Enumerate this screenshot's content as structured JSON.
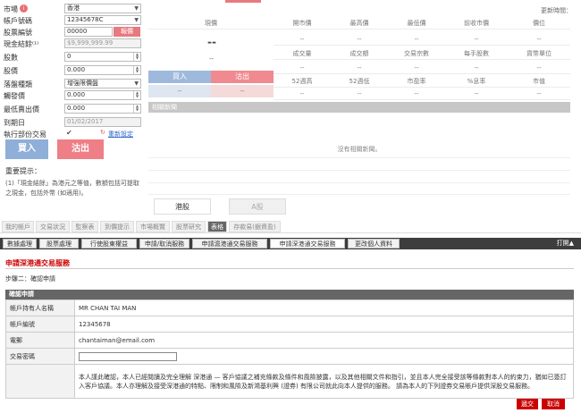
{
  "order": {
    "market_label": "市場",
    "market_value": "香港",
    "account_label": "帳戶號碼",
    "account_value": "12345678C",
    "stock_label": "股票編號",
    "stock_value": "00000",
    "quote_btn": "報價",
    "cash_label": "現金結餘⁽¹⁾",
    "cash_value": "$9,999,999.99",
    "qty_label": "股數",
    "qty_value": "0",
    "price_label": "股價",
    "price_value": "0.000",
    "order_type_label": "落盤種類",
    "order_type_value": "增強限價盤",
    "trigger_label": "觸發價",
    "trigger_value": "0.000",
    "max_label": "最低賣出價",
    "max_value": "0.000",
    "expiry_label": "到期日",
    "expiry_value": "01/02/2017",
    "partial_label": "執行部份交易",
    "reset_label": "重新設定",
    "buy": "買入",
    "sell": "沽出",
    "note_title": "重要提示：",
    "note_body": "(1)「現金結餘」為港元之等值，數額包括可提取之現金，包括外幣 (如適用)。"
  },
  "quote": {
    "update_time": "更新時間：",
    "price_head": "現價",
    "big_dash": "--",
    "small_dash": "--",
    "headers_row1": [
      "開市價",
      "最高價",
      "最低價",
      "前收市價",
      "價位"
    ],
    "values_row1": [
      "--",
      "--",
      "--",
      "--",
      "--"
    ],
    "headers_row2": [
      "成交量",
      "成交額",
      "交易宗數",
      "每手股數",
      "貨幣單位"
    ],
    "values_row2": [
      "--",
      "--",
      "--",
      "--",
      "--"
    ],
    "headers_row3": [
      "52週高",
      "52週低",
      "市盈率",
      "%息率",
      "市值"
    ],
    "values_row3": [
      "--",
      "--",
      "--",
      "--",
      "--"
    ],
    "buy": "買入",
    "sell": "沽出",
    "buy_val": "--",
    "sell_val": "--",
    "news_title": "相關新聞",
    "news_empty": "沒有相關新聞。"
  },
  "market_tabs": {
    "hk": "港股",
    "a": "A股"
  },
  "nav": {
    "items": [
      "我的帳戶",
      "交易狀況",
      "監察表",
      "到價提示",
      "市場概覽",
      "股票研究",
      "表格",
      "存款易(銀資盈)"
    ]
  },
  "subnav": {
    "items": [
      "數據處理",
      "股票處理",
      "行使股東權益",
      "申請/取消服務",
      "申請滬港通交易服務",
      "申請深港通交易服務",
      "更改個人資料"
    ],
    "collapse": "打開▲"
  },
  "form": {
    "title": "申請深港通交易服務",
    "step": "步驟二：確認申請",
    "section": "確認申請",
    "name_label": "帳戶持有人名稱",
    "name_value": "MR CHAN TAI MAN",
    "acct_label": "帳戶編號",
    "acct_value": "12345678",
    "email_label": "電郵",
    "email_value": "chantaiman@email.com",
    "pwd_label": "交易密碼",
    "declaration": "本人謹此確認，本人已經閱讀及完全理解 深港通 — 客戶協議之補充條款及條件和風險披露，以及其他相關文件和指引，並且本人完全接受該等條款對本人的約束力，猶如已簽訂入客戶協議。本人亦理解及接受深港通的特點、限制和風險及新鴻基利興 (證券) 有限公司就此向本人提供的服務。 請為本人的下列證券交易賬戶提供深股交易服務。",
    "submit": "遞交",
    "cancel": "取消"
  }
}
